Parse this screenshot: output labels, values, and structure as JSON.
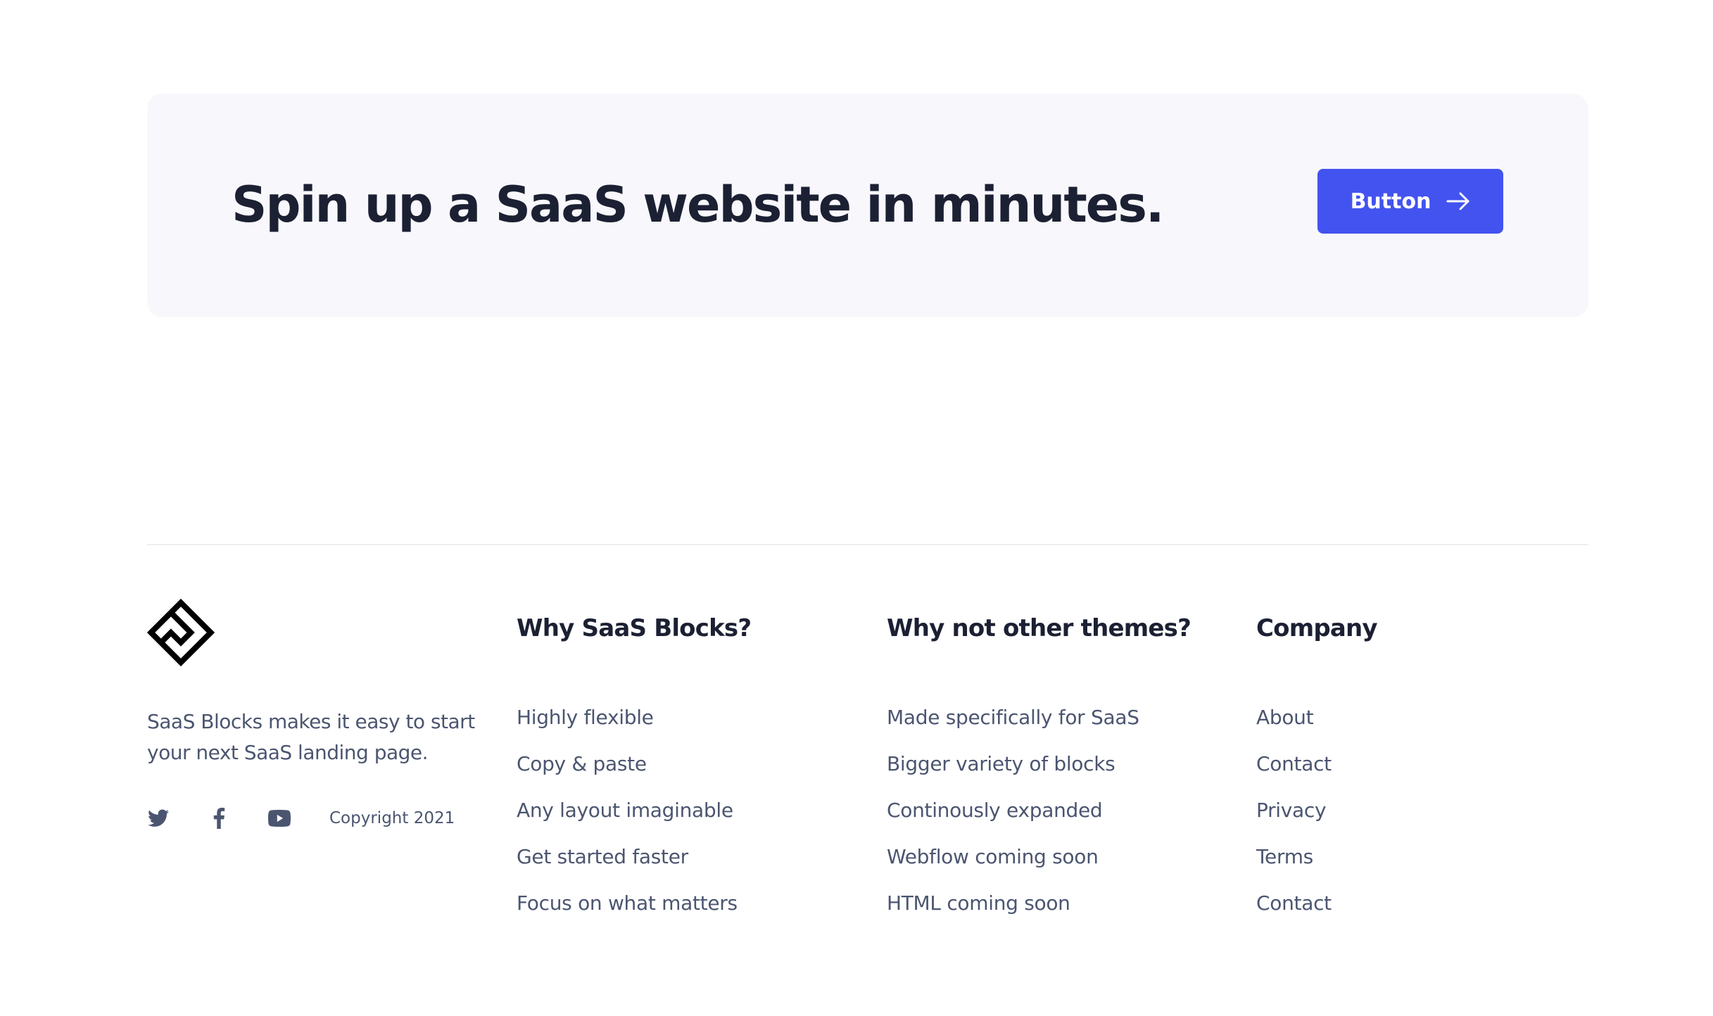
{
  "cta": {
    "title": "Spin up a SaaS website in minutes.",
    "button_label": "Button",
    "button_icon": "arrow-right-icon",
    "button_color": "#4353f0",
    "background": "#f8f8fc"
  },
  "footer": {
    "brand": {
      "logo_icon": "saas-blocks-logo",
      "description": "SaaS Blocks makes it easy to start your next SaaS landing page."
    },
    "social": [
      {
        "icon": "twitter-icon"
      },
      {
        "icon": "facebook-icon"
      },
      {
        "icon": "youtube-icon"
      }
    ],
    "copyright": "Copyright 2021",
    "columns": [
      {
        "title": "Why SaaS Blocks?",
        "links": [
          "Highly flexible",
          "Copy & paste",
          "Any layout imaginable",
          "Get started faster",
          "Focus on what matters"
        ]
      },
      {
        "title": "Why not other themes?",
        "links": [
          "Made specifically for SaaS",
          "Bigger variety of blocks",
          "Continously expanded",
          "Webflow coming soon",
          "HTML coming soon"
        ]
      },
      {
        "title": "Company",
        "links": [
          "About",
          "Contact",
          "Privacy",
          "Terms",
          "Contact"
        ]
      }
    ]
  },
  "colors": {
    "heading": "#1c2033",
    "body_text": "#4b5570",
    "divider": "#ededf2"
  }
}
